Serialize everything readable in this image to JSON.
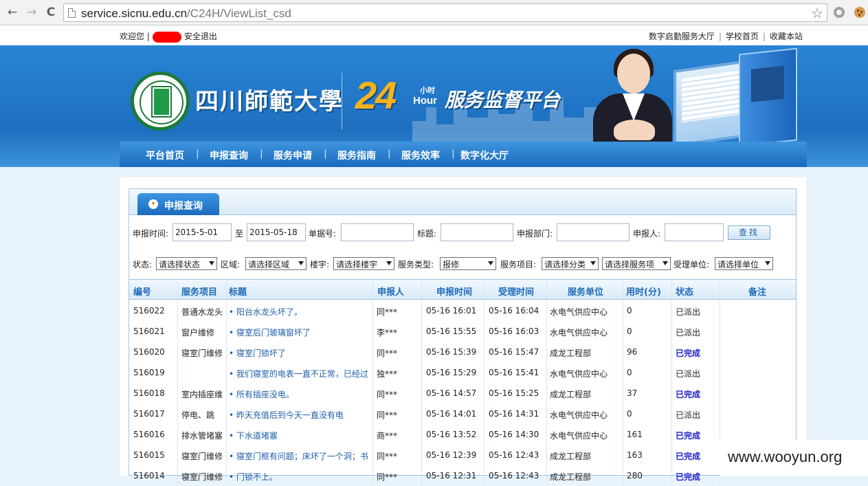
{
  "browser": {
    "url_host": "service.sicnu.edu.cn",
    "url_path": "/C24H/ViewList_csd",
    "back_glyph": "←",
    "forward_glyph": "→",
    "reload_glyph": "C",
    "star_glyph": "☆"
  },
  "topbar": {
    "welcome": "欢迎您 |",
    "logout": "安全退出",
    "links": [
      "数字启勤服务大厅",
      "学校首页",
      "收藏本站"
    ],
    "sep": "|"
  },
  "banner": {
    "school_name": "四川師範大學",
    "num": "24",
    "hour_cn": "小时",
    "hour_en": "Hour",
    "platform": "服务监督平台"
  },
  "menu": {
    "items": [
      "平台首页",
      "申报查询",
      "服务申请",
      "服务指南",
      "服务效率",
      "数字化大厅"
    ],
    "sep": "|"
  },
  "panel": {
    "tab_label": "申报查询",
    "tab_glyph": "▾"
  },
  "search": {
    "time_label": "申报时间:",
    "date_from": "2015-5-01",
    "to_label": "至",
    "date_to": "2015-05-18",
    "order_label": "单据号:",
    "title_label": "标题:",
    "dept_label": "申报部门:",
    "person_label": "申报人:",
    "find_button": "查找",
    "status_label": "状态:",
    "status_value": "请选择状态",
    "area_label": "区域:",
    "area_value": "请选择区域",
    "building_label": "楼宇:",
    "building_value": "请选择楼宇",
    "type_label": "服务类型:",
    "type_value": "报修",
    "item_label": "服务项目:",
    "item_value": "请选择分类",
    "item_value2": "请选择服务项",
    "unit_label": "受理单位:",
    "unit_value": "请选择单位"
  },
  "table": {
    "headers": [
      "编号",
      "服务项目",
      "标题",
      "申报人",
      "申报时间",
      "受理时间",
      "服务单位",
      "用时(分)",
      "状态",
      "备注"
    ],
    "rows": [
      {
        "id": "516022",
        "item": "普通水龙头",
        "title": "• 阳台水龙头坏了。",
        "person": "同***",
        "time": "05-16 16:01",
        "accept": "05-16 16:04",
        "unit": "水电气供应中心",
        "mins": "0",
        "status": "已派出",
        "done": false
      },
      {
        "id": "516021",
        "item": "窗户维修",
        "title": "• 寝室后门玻璃窗坏了",
        "person": "李***",
        "time": "05-16 15:55",
        "accept": "05-16 16:03",
        "unit": "水电气供应中心",
        "mins": "0",
        "status": "已派出",
        "done": false
      },
      {
        "id": "516020",
        "item": "寝室门维修",
        "title": "• 寝室门锁坏了",
        "person": "同***",
        "time": "05-16 15:39",
        "accept": "05-16 15:47",
        "unit": "成龙工程部",
        "mins": "96",
        "status": "已完成",
        "done": true
      },
      {
        "id": "516019",
        "item": "",
        "title": "• 我们寝室的电表一直不正常，已经过",
        "person": "独***",
        "time": "05-16 15:29",
        "accept": "05-16 15:41",
        "unit": "水电气供应中心",
        "mins": "0",
        "status": "已派出",
        "done": false
      },
      {
        "id": "516018",
        "item": "室内插座维",
        "title": "• 所有插座没电。",
        "person": "同***",
        "time": "05-16 14:57",
        "accept": "05-16 15:25",
        "unit": "成龙工程部",
        "mins": "37",
        "status": "已完成",
        "done": true
      },
      {
        "id": "516017",
        "item": "停电、跳",
        "title": "• 昨天充值后到今天一直没有电",
        "person": "同***",
        "time": "05-16 14:01",
        "accept": "05-16 14:31",
        "unit": "水电气供应中心",
        "mins": "0",
        "status": "已派出",
        "done": false
      },
      {
        "id": "516016",
        "item": "排水管堵塞",
        "title": "• 下水道堵塞",
        "person": "商***",
        "time": "05-16 13:52",
        "accept": "05-16 14:30",
        "unit": "水电气供应中心",
        "mins": "161",
        "status": "已完成",
        "done": true
      },
      {
        "id": "516015",
        "item": "寝室门维修",
        "title": "• 寝室门框有问题；床坏了一个洞；书",
        "person": "同***",
        "time": "05-16 12:39",
        "accept": "05-16 12:43",
        "unit": "成龙工程部",
        "mins": "163",
        "status": "已完成",
        "done": true
      },
      {
        "id": "516014",
        "item": "寝室门维修",
        "title": "• 门锁不上。",
        "person": "同***",
        "time": "05-16 12:31",
        "accept": "05-16 12:43",
        "unit": "成龙工程部",
        "mins": "280",
        "status": "已完成",
        "done": true
      }
    ]
  },
  "watermark": "www.wooyun.org"
}
